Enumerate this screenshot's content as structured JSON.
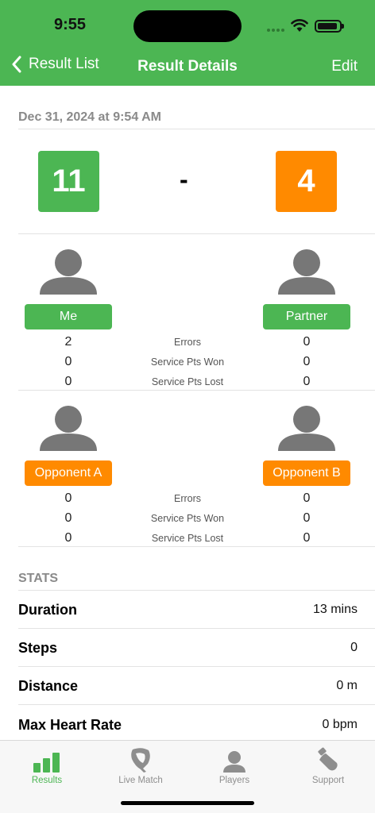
{
  "status": {
    "time": "9:55"
  },
  "nav": {
    "back_label": "Result List",
    "title": "Result Details",
    "edit_label": "Edit"
  },
  "result": {
    "date": "Dec 31, 2024 at 9:54 AM",
    "score_me": "11",
    "separator": "-",
    "score_opp": "4"
  },
  "team1": {
    "left_name": "Me",
    "right_name": "Partner",
    "rows": [
      {
        "label": "Errors",
        "left": "2",
        "right": "0"
      },
      {
        "label": "Service Pts Won",
        "left": "0",
        "right": "0"
      },
      {
        "label": "Service Pts Lost",
        "left": "0",
        "right": "0"
      }
    ]
  },
  "team2": {
    "left_name": "Opponent A",
    "right_name": "Opponent B",
    "rows": [
      {
        "label": "Errors",
        "left": "0",
        "right": "0"
      },
      {
        "label": "Service Pts Won",
        "left": "0",
        "right": "0"
      },
      {
        "label": "Service Pts Lost",
        "left": "0",
        "right": "0"
      }
    ]
  },
  "stats": {
    "header": "STATS",
    "items": [
      {
        "label": "Duration",
        "value": "13 mins"
      },
      {
        "label": "Steps",
        "value": "0"
      },
      {
        "label": "Distance",
        "value": "0 m"
      },
      {
        "label": "Max Heart Rate",
        "value": "0 bpm"
      }
    ]
  },
  "tabs": [
    {
      "label": "Results",
      "icon": "bar-chart-icon"
    },
    {
      "label": "Live Match",
      "icon": "paddle-icon"
    },
    {
      "label": "Players",
      "icon": "person-icon"
    },
    {
      "label": "Support",
      "icon": "bottle-icon"
    }
  ],
  "colors": {
    "accent_green": "#4cb653",
    "accent_orange": "#ff8a00"
  }
}
